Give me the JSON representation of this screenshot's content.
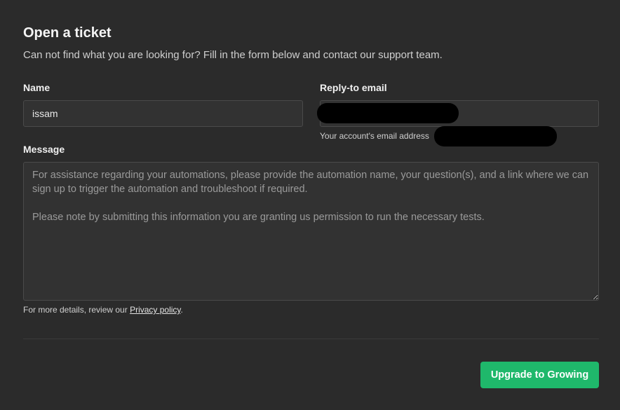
{
  "header": {
    "title": "Open a ticket",
    "subtitle": "Can not find what you are looking for? Fill in the form below and contact our support team."
  },
  "form": {
    "name_label": "Name",
    "name_value": "issam",
    "email_label": "Reply-to email",
    "email_value": "",
    "email_hint": "Your account's email address",
    "message_label": "Message",
    "message_placeholder": "For assistance regarding your automations, please provide the automation name, your question(s), and a link where we can sign up to trigger the automation and troubleshoot if required.\n\nPlease note by submitting this information you are granting us permission to run the necessary tests.",
    "privacy_prefix": "For more details, review our ",
    "privacy_link": "Privacy policy",
    "privacy_suffix": "."
  },
  "footer": {
    "submit_label": "Upgrade to Growing"
  },
  "colors": {
    "background": "#2b2b2b",
    "accent": "#1fb86b"
  }
}
